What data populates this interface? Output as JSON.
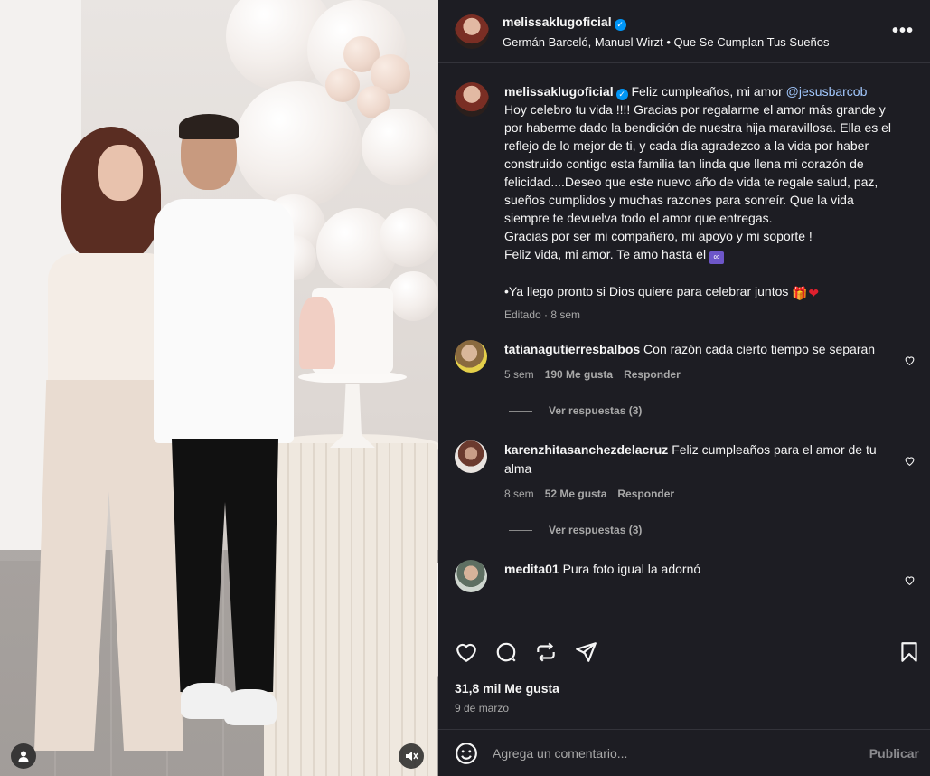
{
  "header": {
    "username": "melissaklugoficial",
    "audio": "Germán Barceló, Manuel Wirzt • Que Se Cumplan Tus Sueños",
    "more_label": "•••"
  },
  "caption": {
    "username": "melissaklugoficial",
    "intro": " Feliz cumpleaños, mi amor ",
    "mention": "@jesusbarcob",
    "line1": "Hoy celebro tu vida !!!! Gracias por regalarme el amor más grande y por haberme dado la bendición de nuestra hija maravillosa. Ella es el reflejo de lo mejor de ti, y cada día agradezco a la vida por haber construido contigo esta familia tan linda que llena mi corazón de felicidad....Deseo que este nuevo año de vida te regale salud, paz, sueños cumplidos y muchas razones para sonreír. Que la vida siempre te devuelva todo el amor que entregas.",
    "line2": "Gracias por ser mi compañero, mi apoyo y mi soporte !",
    "line3": "Feliz vida, mi amor. Te amo hasta el",
    "infinity": "∞",
    "line4": "•Ya llego pronto si Dios quiere para celebrar juntos",
    "edited": "Editado",
    "time": "8 sem"
  },
  "comments": [
    {
      "username": "tatianagutierresbalbos",
      "text": "Con razón cada cierto tiempo se separan",
      "time": "5 sem",
      "likes": "190 Me gusta",
      "reply": "Responder",
      "view_replies": "Ver respuestas (3)"
    },
    {
      "username": "karenzhitasanchezdelacruz",
      "text": "Feliz cumpleaños para el amor de tu alma",
      "time": "8 sem",
      "likes": "52 Me gusta",
      "reply": "Responder",
      "view_replies": "Ver respuestas (3)"
    },
    {
      "username": "medita01",
      "text": "Pura foto igual la adornó"
    }
  ],
  "likes_count": "31,8 mil Me gusta",
  "date": "9 de marzo",
  "add_comment": {
    "placeholder": "Agrega un comentario...",
    "publish": "Publicar"
  },
  "colors": {
    "panel_bg": "#1d1d23",
    "verified_blue": "#0095f6",
    "muted_text": "#a8a8a8"
  }
}
